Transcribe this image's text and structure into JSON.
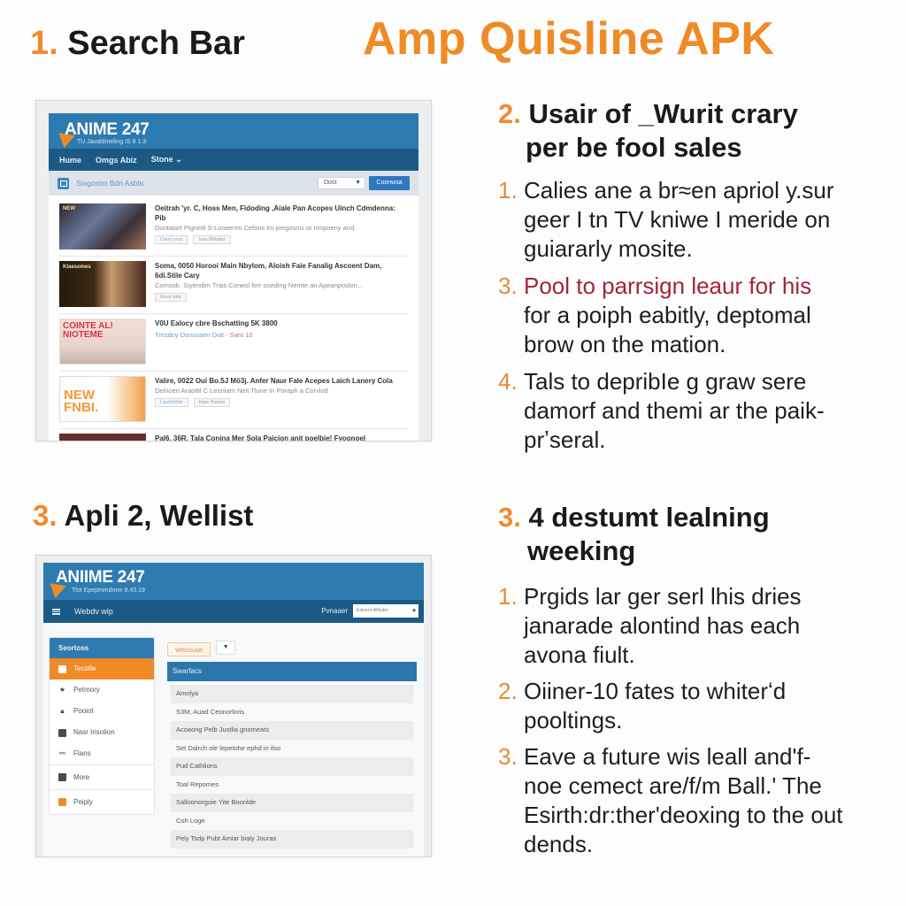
{
  "page": {
    "main_title": "Amp Quisline APK",
    "colors": {
      "accent_orange": "#f08a24",
      "header_blue": "#2e7bb1",
      "nav_dark_blue": "#1c5a85",
      "highlight_red": "#a4233a"
    }
  },
  "sections": {
    "s1": {
      "num": "1.",
      "title": "Search Bar"
    },
    "s2": {
      "num": "2.",
      "title_lines": [
        "Usair of _Wurit crary",
        "per be fool sales"
      ]
    },
    "s3_left": {
      "num": "3.",
      "title": "Apli 2, Wellist"
    },
    "s3_right": {
      "num": "3.",
      "title_lines": [
        "4 destumt lealning",
        "weeking"
      ]
    }
  },
  "panel1": {
    "logo": "ANIME 247",
    "tagline": "TU Javaldmeling IS 8 1.3",
    "nav": [
      "Hume",
      "Omgs Abiz",
      "Stone ⌄"
    ],
    "search_label": "Siogostm Bdn Asblic",
    "search_icon": "search-icon",
    "sort_value": "Dost",
    "search_button": "Coonwsa",
    "results": [
      {
        "thumb_text": "NEW",
        "title": "Oeitrah 'yr. C, Hoss Men, Fidoding ,Aiale Pan Acopes Uinch Cdmdenna: Pib",
        "desc": "Dontatart Pignetli S-Loooenm Cefons lm pregosnis or nmpoeny and.",
        "tags": [
          "Uand enta",
          "Ivas Wthdas"
        ]
      },
      {
        "thumb_text": "Klaesomes",
        "title": "Soma, 0050 Horooi Main Nbylom, Aloish Faie Fanalig Ascoent Dam, 6di.Stile Cary",
        "desc": "Comsob. Siyendim Trais Coneol forr oseding Nemte an Apeanposlon...",
        "tags": [
          "Irlves bbs"
        ]
      },
      {
        "thumb_text": "COINTE AL! NIOTEME",
        "title": "V0U Ealocy cbre Bschatting 5K 3800",
        "meta": "Tmsdoy Dsnosaen Diat",
        "meta_extra": "- Sant 10",
        "tags": []
      },
      {
        "thumb_text": "NEW FNBI.",
        "title": "Valire, 0022 Oui Bo.5J Mö3j. Anfer Naur Fale Acepes Laich Lanery Cola",
        "desc": "Delnoen Araoitil C Leoniam Neit Tlune In Poraph a Corvlod",
        "tags": [
          "Laotirtidde",
          "Kate Pialom"
        ]
      },
      {
        "thumb_text": "",
        "title": "Pal6, 36R, Tala Conina Mer Sola Paicion anit poelbie! Fyoonoel",
        "desc": "",
        "tags": []
      }
    ]
  },
  "panel2": {
    "logo": "ANIIME 247",
    "tagline": "Tlot Epepmmdmnr 8.43.19",
    "nav_menu": "Webdv wip",
    "nav_right_label": "Pvnaaer",
    "nav_select_value": "Edozor Ahtuler",
    "sidebar_header": "Seortoss",
    "sidebar_items": [
      {
        "label": "Tecotle",
        "icon": "square-icon",
        "active": true
      },
      {
        "label": "Petmory",
        "icon": "star-icon"
      },
      {
        "label": "Pooiot",
        "icon": "lock-icon"
      },
      {
        "label": "Nasr Irisolion",
        "icon": "calendar-icon"
      },
      {
        "label": "Flans",
        "icon": "network-icon"
      },
      {
        "label": "More",
        "icon": "folder-icon",
        "sep": true
      },
      {
        "label": "Peiply",
        "icon": "chat-icon",
        "sep": true
      }
    ],
    "filter_button": "Wecouse",
    "filter_dropdown": "▼",
    "list_header": "Swarfacs",
    "list_rows": [
      "Amnlya",
      "S3M, Auad Ceonorloris",
      "Acoaong Pelb Justlia gnomeats",
      "Set Dalrch ole lepetohe ephd in ilso",
      "Pud Cathlions",
      "Toal Repomes",
      "Salloonorgoie Yite Boonlde",
      "Coh Loge",
      "Pely Tsdp Pubt Amiar bialy Jouras"
    ]
  },
  "right_lists": {
    "list1": [
      {
        "num": "1.",
        "lines": [
          "Calies ane a br≈en apriol y.sur",
          "geer I tn TV kniwe I meride on",
          "guiararly mosite."
        ]
      },
      {
        "num": "3.",
        "highlight": true,
        "lines": [
          "Pool to parrsign leaur for his",
          "for a poiph eabitly, deptomal",
          "brow on the mation."
        ]
      },
      {
        "num": "4.",
        "lines": [
          "Tals to depribIe g graw sere",
          "damorf and themi ar the paik-",
          "prʼseral."
        ]
      }
    ],
    "list2": [
      {
        "num": "1.",
        "lines": [
          "Prɡids lar ger serl lhis dries",
          "janarade alontind has each",
          "avona fiult."
        ]
      },
      {
        "num": "2.",
        "lines": [
          "Oiiner-10 fates to whiterʻd",
          "pooltings."
        ]
      },
      {
        "num": "3.",
        "lines": [
          "Eave a future wis leall and'f-",
          "noe cemect are/f/m Ball.' The",
          "Esirth:dr:ther'deoxing to the out",
          "dends."
        ]
      }
    ]
  }
}
